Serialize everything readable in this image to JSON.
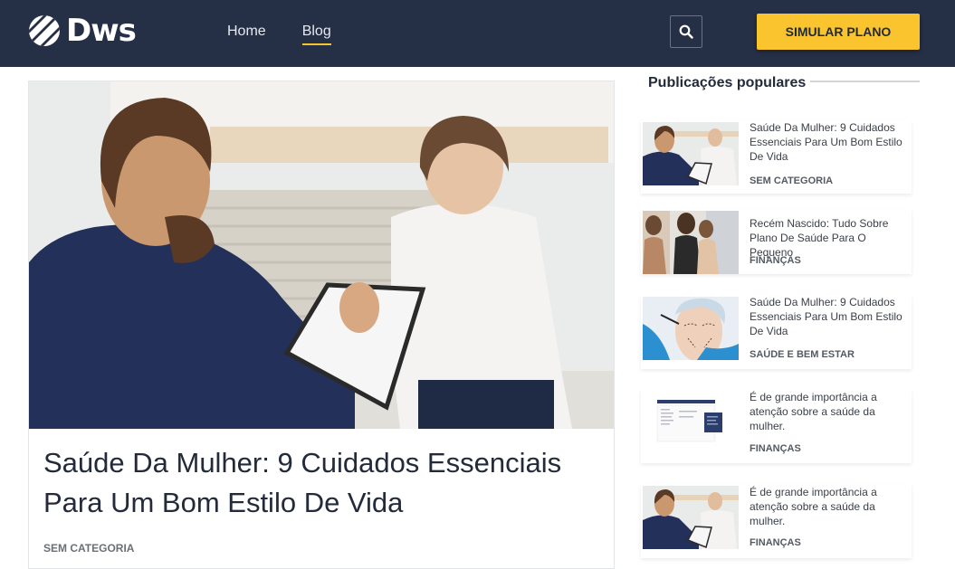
{
  "header": {
    "logo_text": "Dws",
    "nav": [
      {
        "label": "Home",
        "active": false
      },
      {
        "label": "Blog",
        "active": true
      }
    ],
    "search_icon": "search-icon",
    "cta_label": "SIMULAR PLANO"
  },
  "feature": {
    "title": "Saúde Da Mulher: 9 Cuidados Essenciais Para Um Bom Estilo De Vida",
    "category": "SEM CATEGORIA"
  },
  "sidebar": {
    "title": "Publicações populares",
    "posts": [
      {
        "title": "Saúde Da Mulher: 9 Cuidados Essenciais Para Um Bom Estilo De Vida",
        "category": "SEM CATEGORIA"
      },
      {
        "title": "Recém Nascido: Tudo Sobre Plano De Saúde Para O Pequeno",
        "category": "FINANÇAS"
      },
      {
        "title": "Saúde Da Mulher: 9 Cuidados Essenciais Para Um Bom Estilo De Vida",
        "category": "SAÚDE E BEM ESTAR"
      },
      {
        "title": "É de grande importância a atenção sobre a saúde da mulher.",
        "category": "FINANÇAS"
      },
      {
        "title": "É de grande importância a atenção sobre a saúde da mulher.",
        "category": "FINANÇAS"
      }
    ]
  },
  "colors": {
    "header_bg": "#252f45",
    "accent": "#f9c42e",
    "text_dark": "#232b3b"
  }
}
